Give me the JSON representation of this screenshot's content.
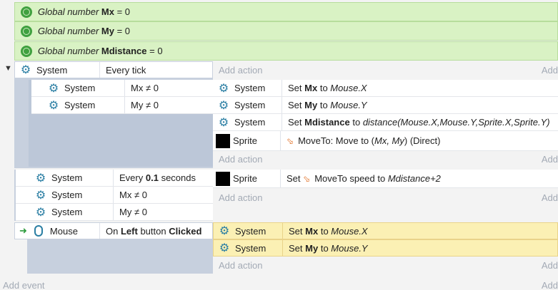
{
  "globals": [
    {
      "prefix": "Global number",
      "name": "Mx",
      "suffix": "= 0"
    },
    {
      "prefix": "Global number",
      "name": "My",
      "suffix": "= 0"
    },
    {
      "prefix": "Global number",
      "name": "Mdistance",
      "suffix": "= 0"
    }
  ],
  "events": {
    "collapse_glyph": "▼",
    "e1": {
      "object": "System",
      "condition": "Every tick",
      "add_action": "Add action",
      "add_action_right": "Add",
      "sub": {
        "conditions": [
          {
            "object": "System",
            "text": "Mx ≠ 0"
          },
          {
            "object": "System",
            "text": "My ≠ 0"
          }
        ],
        "actions": [
          {
            "object": "System",
            "verb": "Set",
            "bold": "Mx",
            "mid": "to",
            "value": "Mouse.X"
          },
          {
            "object": "System",
            "verb": "Set",
            "bold": "My",
            "mid": "to",
            "value": "Mouse.Y"
          },
          {
            "object": "System",
            "verb": "Set",
            "bold": "Mdistance",
            "mid": "to",
            "value": "distance(Mouse.X,Mouse.Y,Sprite.X,Sprite.Y)"
          },
          {
            "object": "Sprite",
            "text": "MoveTo: Move to (",
            "italic": "Mx, My",
            ")rest": ") (Direct)"
          }
        ],
        "add_action": "Add action",
        "add_action_right": "Add"
      }
    },
    "e2": {
      "conditions": [
        {
          "object": "System",
          "pre": "Every",
          "bold": "0.1",
          "post": "seconds"
        },
        {
          "object": "System",
          "text": "Mx ≠ 0"
        },
        {
          "object": "System",
          "text": "My ≠ 0"
        }
      ],
      "actions": [
        {
          "object": "Sprite",
          "verb": "Set",
          "mid": "MoveTo speed to",
          "value": "Mdistance+2"
        }
      ],
      "add_action": "Add action",
      "add_action_right": "Add"
    },
    "e3": {
      "arrow": "➜",
      "object": "Mouse",
      "pre": "On",
      "bold1": "Left",
      "mid": "button",
      "bold2": "Clicked",
      "actions": [
        {
          "object": "System",
          "verb": "Set",
          "bold": "Mx",
          "mid": "to",
          "value": "Mouse.X"
        },
        {
          "object": "System",
          "verb": "Set",
          "bold": "My",
          "mid": "to",
          "value": "Mouse.Y"
        }
      ],
      "add_action": "Add action",
      "add_action_right": "Add"
    },
    "add_event": "Add event",
    "add_event_right": "Add"
  },
  "icons": {
    "gear": "gear-icon",
    "globe": "globe-icon",
    "sprite": "sprite-thumbnail",
    "mouse": "mouse-icon",
    "moveto": "moveto-behavior-icon"
  },
  "colors": {
    "global_bg": "#d9f2c4",
    "highlight": "#fbf0b4",
    "block": "#c7d0de",
    "accent": "#2a7ea3"
  }
}
